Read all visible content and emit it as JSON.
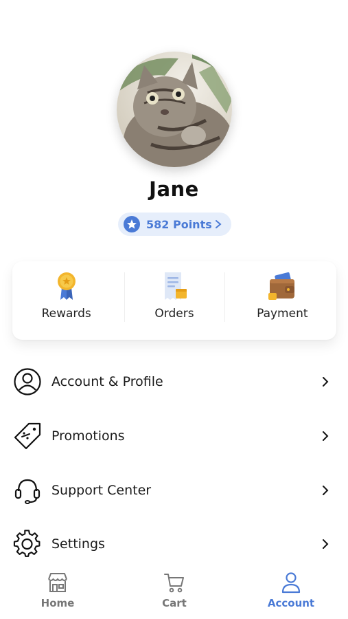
{
  "profile": {
    "name": "Jane",
    "points_label": "582 Points"
  },
  "quick_actions": [
    {
      "label": "Rewards",
      "icon": "medal-icon"
    },
    {
      "label": "Orders",
      "icon": "receipt-icon"
    },
    {
      "label": "Payment",
      "icon": "wallet-icon"
    }
  ],
  "menu": [
    {
      "label": "Account & Profile",
      "icon": "user-circle-icon"
    },
    {
      "label": "Promotions",
      "icon": "discount-tag-icon"
    },
    {
      "label": "Support Center",
      "icon": "headset-icon"
    },
    {
      "label": "Settings",
      "icon": "gear-icon"
    }
  ],
  "bottom_nav": [
    {
      "label": "Home",
      "icon": "store-icon",
      "active": false
    },
    {
      "label": "Cart",
      "icon": "cart-icon",
      "active": false
    },
    {
      "label": "Account",
      "icon": "person-icon",
      "active": true
    }
  ],
  "colors": {
    "accent": "#4a7ad6",
    "pill_bg": "#e6eefb",
    "inactive": "#777777"
  }
}
